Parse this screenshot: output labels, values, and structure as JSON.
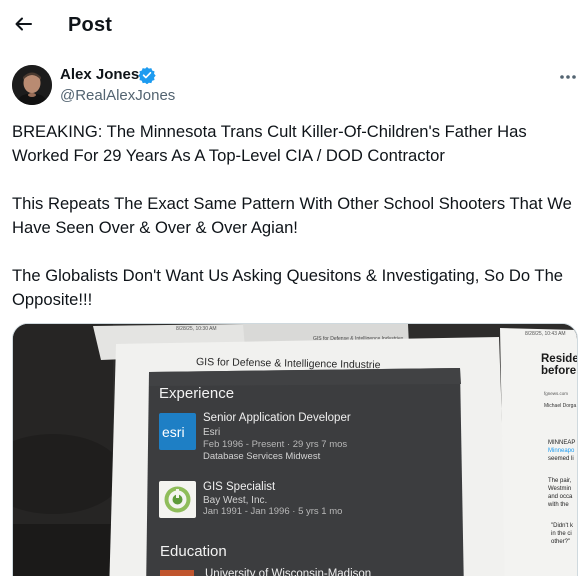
{
  "header": {
    "title": "Post"
  },
  "author": {
    "display_name": "Alex Jones",
    "handle": "@RealAlexJones",
    "verified": true
  },
  "post": {
    "paragraphs": [
      "BREAKING: The Minnesota Trans Cult Killer-Of-Children's Father Has Worked For 29 Years As A Top-Level CIA / DOD Contractor",
      "This Repeats The Exact Same Pattern With Other School Shooters That We Have Seen Over & Over & Over Agian!",
      "The Globalists Don't Want Us Asking Quesitons & Investigating, So Do The Opposite!!!"
    ]
  },
  "media": {
    "left_stamp": "8/28/25, 10:30 AM",
    "left_header": "GIS for Defense & Intelligence Industries",
    "doc_heading": "GIS for Defense & Intelligence Industrie",
    "experience_heading": "Experience",
    "jobs": [
      {
        "logo_text": "esri",
        "title": "Senior Application Developer",
        "company": "Esri",
        "dates": "Feb 1996 - Present · 29 yrs 7 mos",
        "detail": "Database Services Midwest"
      },
      {
        "logo_text": "",
        "title": "GIS Specialist",
        "company": "Bay West, Inc.",
        "dates": "Jan 1991 - Jan 1996 · 5 yrs 1 mo",
        "detail": ""
      }
    ],
    "education_heading": "Education",
    "education_first": "University of Wisconsin-Madison",
    "right_stamp": "8/28/25, 10:43 AM",
    "right_headline": [
      "Resider",
      "before c"
    ],
    "right_site": "fgnews.com",
    "right_byline": "Michael Dorga",
    "right_body": [
      "MINNEAP",
      "Minneapo",
      "seemed li",
      "The pair,",
      "Westmin",
      "and occa",
      "with the",
      "\"Didn't k",
      "in the ci",
      "other?\""
    ],
    "colors": {
      "esri_blue": "#1e7fc5",
      "card_bg": "#3c3d3f",
      "link_blue": "#1d9bf0"
    }
  }
}
